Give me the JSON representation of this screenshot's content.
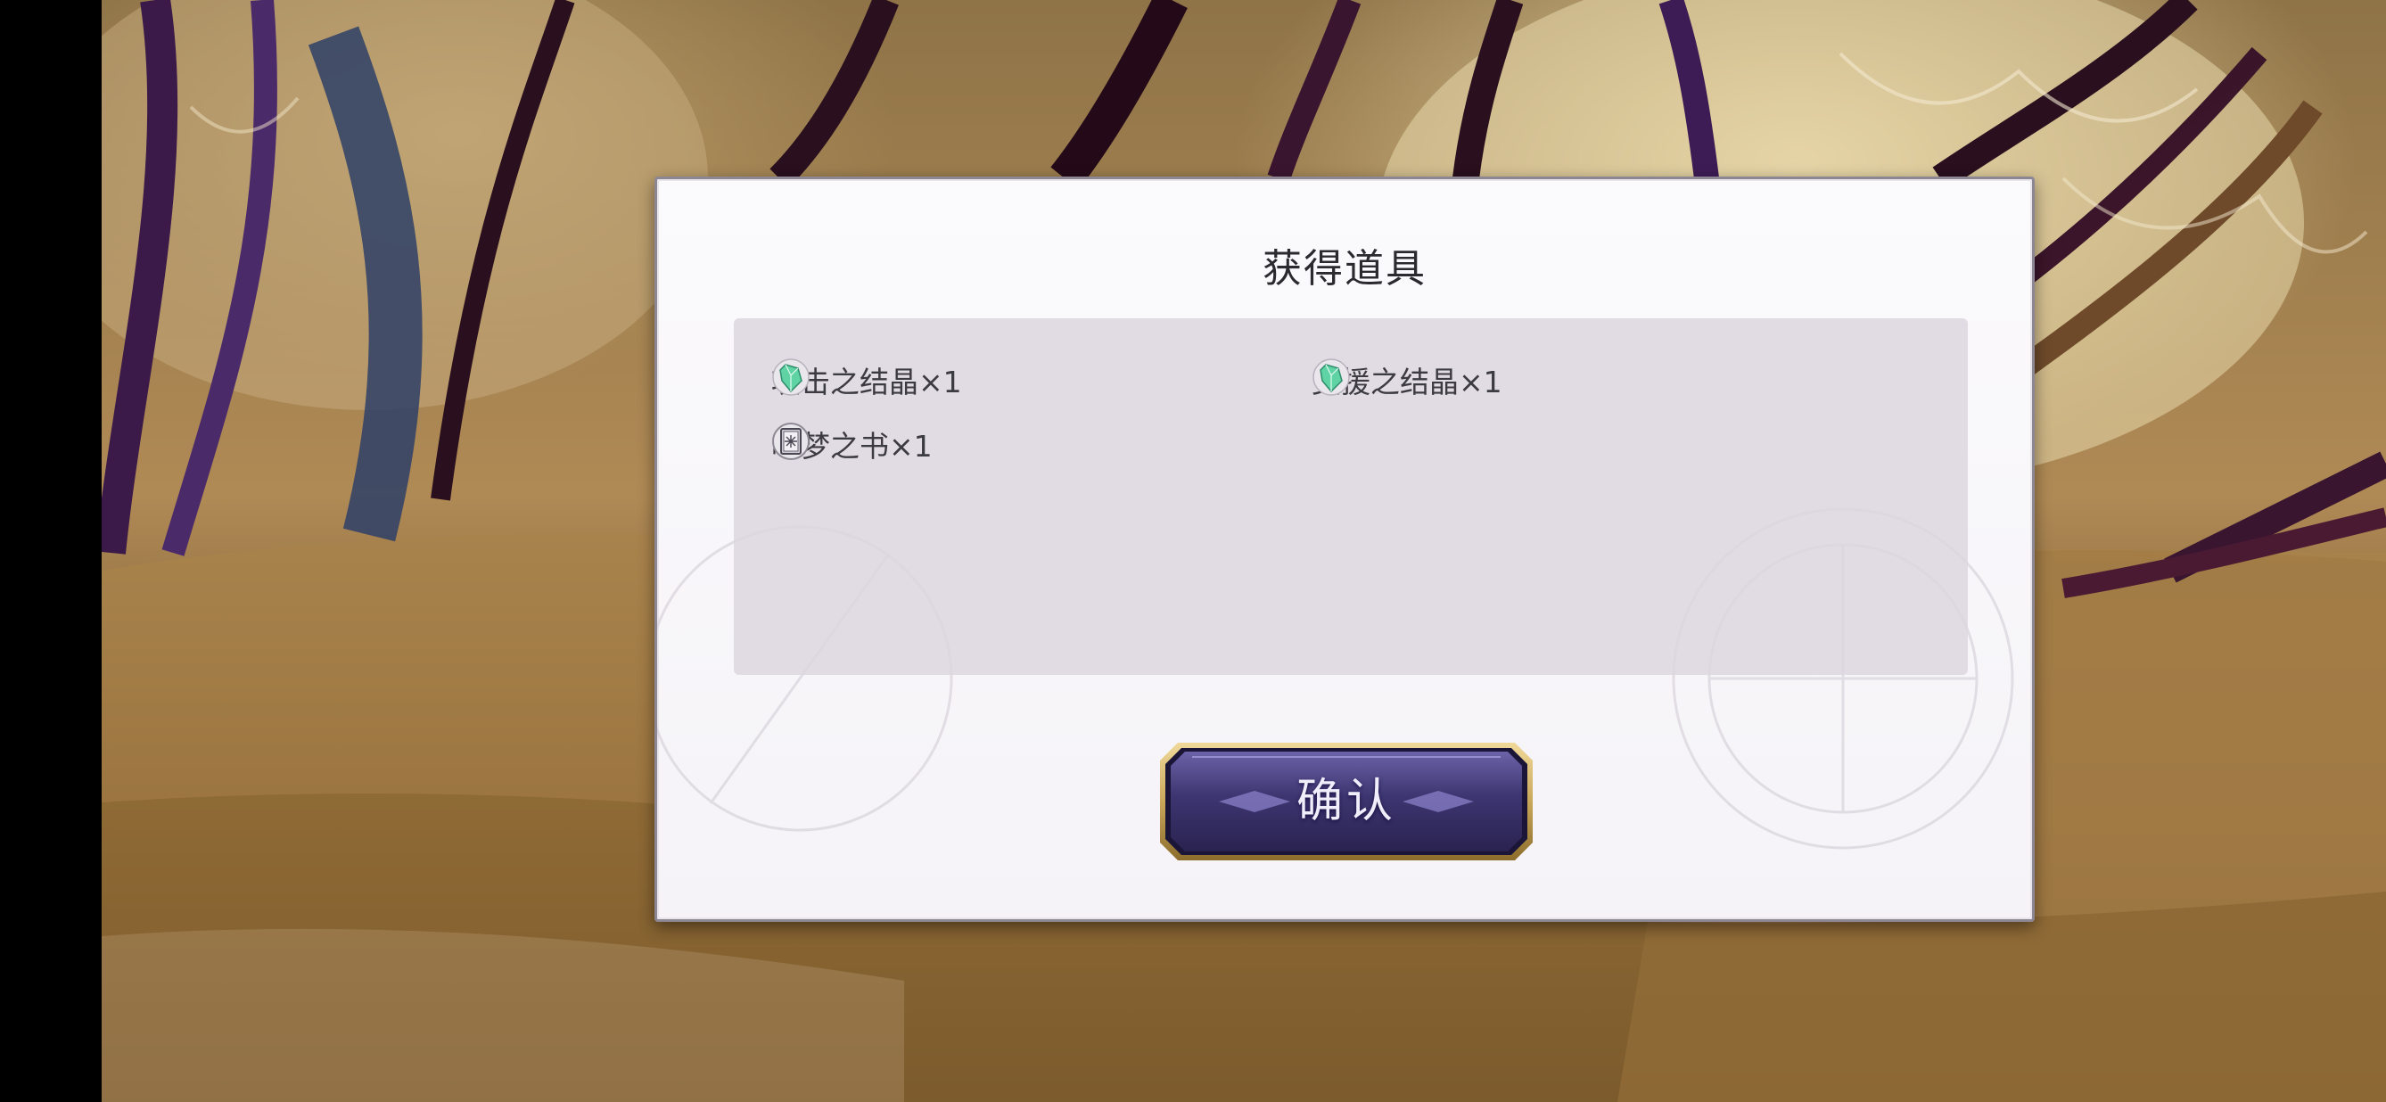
{
  "dialog": {
    "title": "获得道具",
    "items": [
      {
        "label": "攻击之结晶×1",
        "icon": "green-crystal-icon"
      },
      {
        "label": "支援之结晶×1",
        "icon": "green-crystal-icon"
      },
      {
        "label": "咏梦之书×1",
        "icon": "book-icon"
      }
    ],
    "confirm_label": "确认"
  },
  "colors": {
    "dialog_bg": "#f8f6fa",
    "panel_bg": "#dcd6de",
    "button_purple": "#3d3570",
    "button_gold": "#c9a85a",
    "crystal_green": "#5fd3a4"
  }
}
